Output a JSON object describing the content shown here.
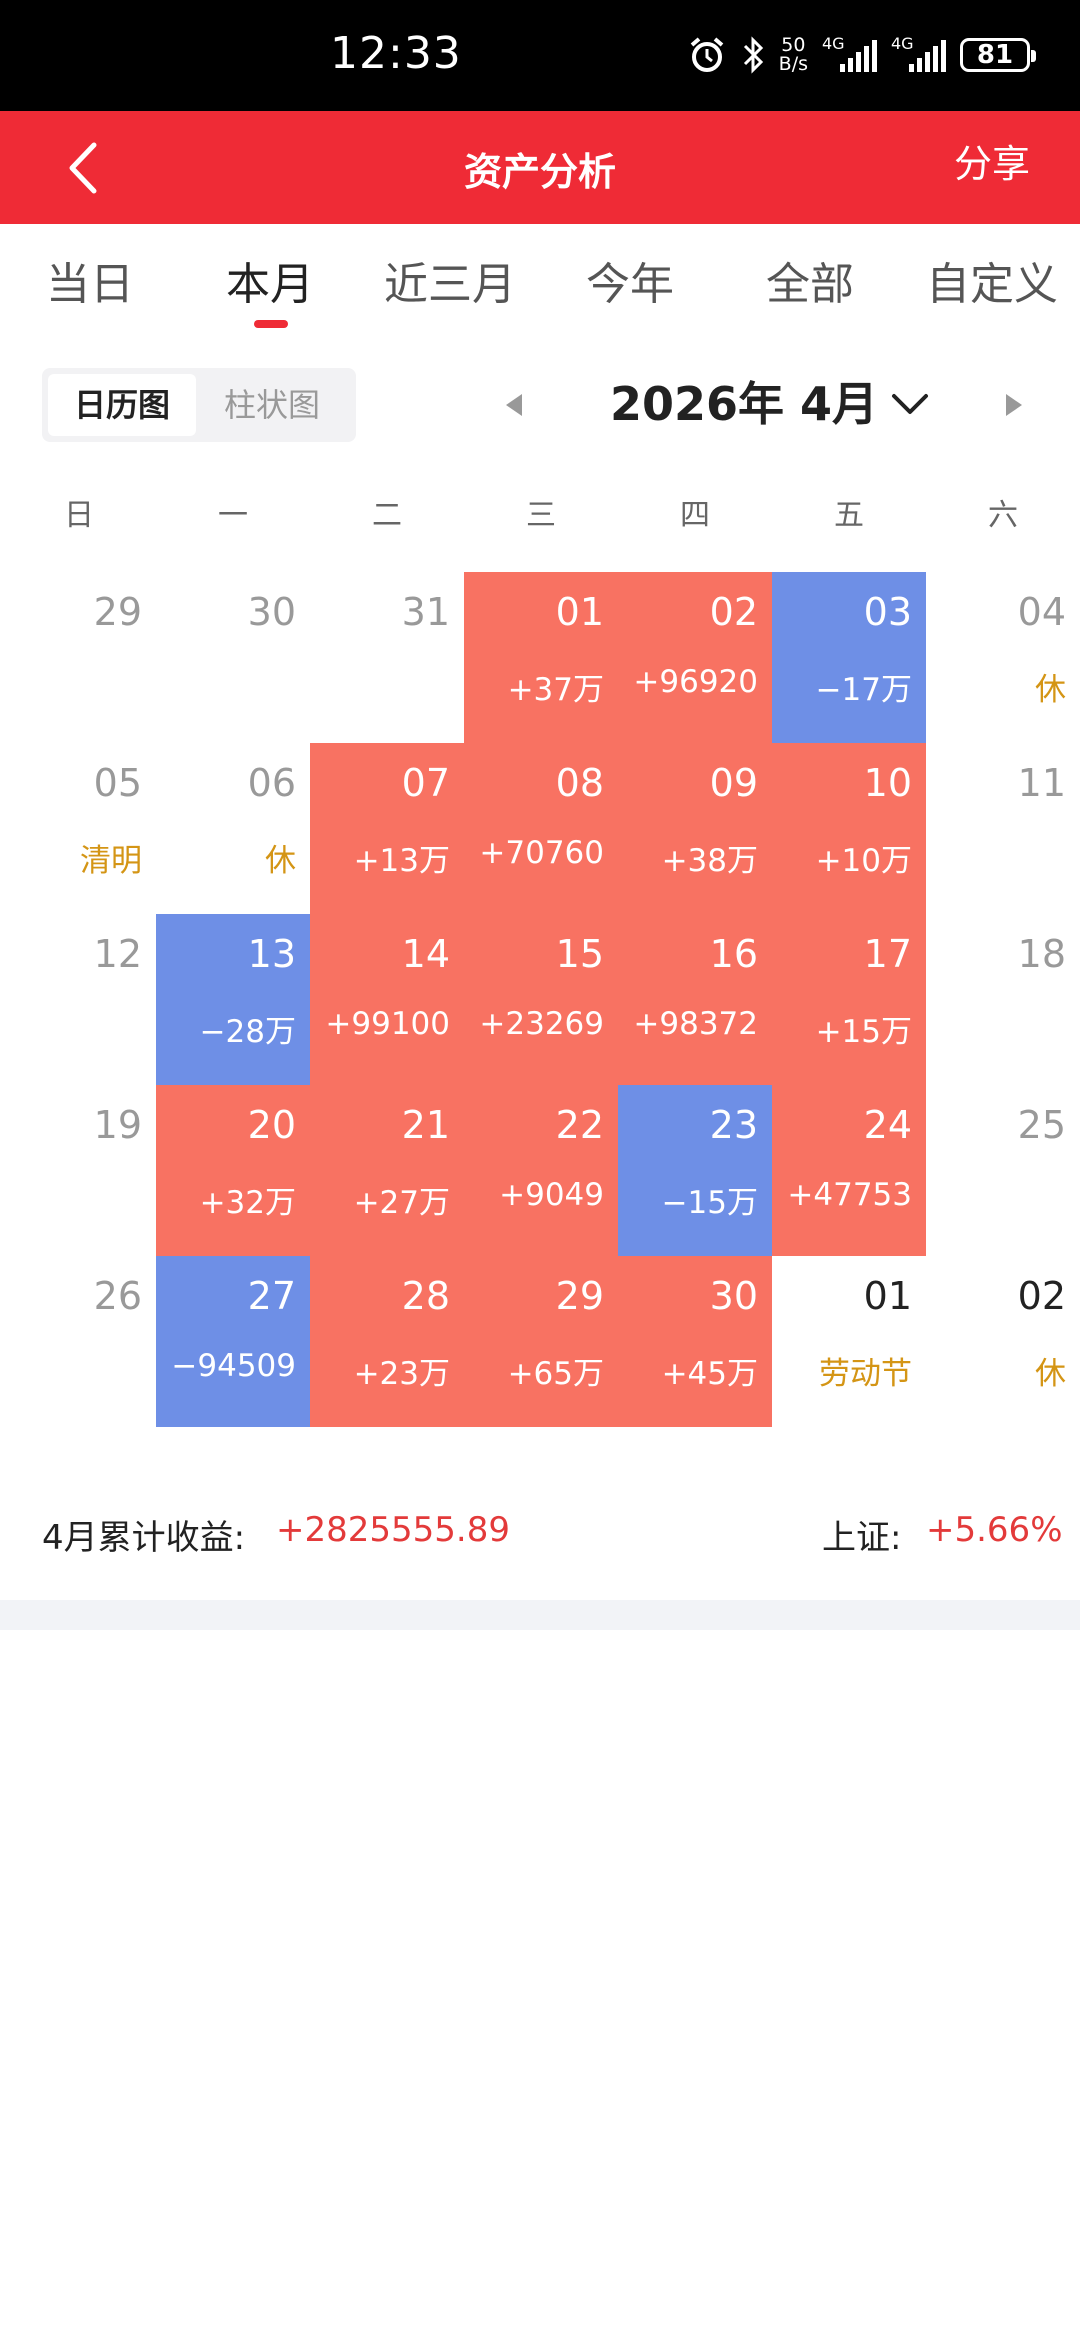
{
  "status_bar": {
    "time": "12:33",
    "net_speed_value": "50",
    "net_speed_unit": "B/s",
    "sim1_label": "4G",
    "sim2_label": "4G",
    "battery": "81"
  },
  "header": {
    "title": "资产分析",
    "share_label": "分享"
  },
  "period_tabs": [
    {
      "label": "当日",
      "active": false
    },
    {
      "label": "本月",
      "active": true
    },
    {
      "label": "近三月",
      "active": false
    },
    {
      "label": "今年",
      "active": false
    },
    {
      "label": "全部",
      "active": false
    },
    {
      "label": "自定义",
      "active": false
    }
  ],
  "view_toggle": {
    "calendar_label": "日历图",
    "bar_label": "柱状图"
  },
  "month_nav": {
    "label": "2026年 4月"
  },
  "weekdays": [
    "日",
    "一",
    "二",
    "三",
    "四",
    "五",
    "六"
  ],
  "calendar": [
    [
      {
        "day": "29",
        "note": "",
        "state": "muted"
      },
      {
        "day": "30",
        "note": "",
        "state": "muted"
      },
      {
        "day": "31",
        "note": "",
        "state": "muted"
      },
      {
        "day": "01",
        "note": "+37万",
        "state": "gain"
      },
      {
        "day": "02",
        "note": "+96920",
        "state": "gain"
      },
      {
        "day": "03",
        "note": "−17万",
        "state": "loss"
      },
      {
        "day": "04",
        "note": "休",
        "state": "muted"
      }
    ],
    [
      {
        "day": "05",
        "note": "清明",
        "state": "muted"
      },
      {
        "day": "06",
        "note": "休",
        "state": "muted"
      },
      {
        "day": "07",
        "note": "+13万",
        "state": "gain"
      },
      {
        "day": "08",
        "note": "+70760",
        "state": "gain"
      },
      {
        "day": "09",
        "note": "+38万",
        "state": "gain"
      },
      {
        "day": "10",
        "note": "+10万",
        "state": "gain"
      },
      {
        "day": "11",
        "note": "",
        "state": "muted"
      }
    ],
    [
      {
        "day": "12",
        "note": "",
        "state": "muted"
      },
      {
        "day": "13",
        "note": "−28万",
        "state": "loss"
      },
      {
        "day": "14",
        "note": "+99100",
        "state": "gain"
      },
      {
        "day": "15",
        "note": "+23269",
        "state": "gain"
      },
      {
        "day": "16",
        "note": "+98372",
        "state": "gain"
      },
      {
        "day": "17",
        "note": "+15万",
        "state": "gain"
      },
      {
        "day": "18",
        "note": "",
        "state": "muted"
      }
    ],
    [
      {
        "day": "19",
        "note": "",
        "state": "muted"
      },
      {
        "day": "20",
        "note": "+32万",
        "state": "gain"
      },
      {
        "day": "21",
        "note": "+27万",
        "state": "gain"
      },
      {
        "day": "22",
        "note": "+9049",
        "state": "gain"
      },
      {
        "day": "23",
        "note": "−15万",
        "state": "loss"
      },
      {
        "day": "24",
        "note": "+47753",
        "state": "gain"
      },
      {
        "day": "25",
        "note": "",
        "state": "muted"
      }
    ],
    [
      {
        "day": "26",
        "note": "",
        "state": "muted"
      },
      {
        "day": "27",
        "note": "−94509",
        "state": "loss"
      },
      {
        "day": "28",
        "note": "+23万",
        "state": "gain"
      },
      {
        "day": "29",
        "note": "+65万",
        "state": "gain"
      },
      {
        "day": "30",
        "note": "+45万",
        "state": "gain"
      },
      {
        "day": "01",
        "note": "劳动节",
        "state": "plain"
      },
      {
        "day": "02",
        "note": "休",
        "state": "plain"
      }
    ]
  ],
  "summary": {
    "label": "4月累计收益:",
    "value": "+2825555.89",
    "index_label": "上证:",
    "index_value": "+5.66%"
  },
  "colors": {
    "accent": "#ef2b36",
    "gain": "#f87262",
    "loss": "#6e8fe6",
    "holiday_text": "#d49515"
  }
}
